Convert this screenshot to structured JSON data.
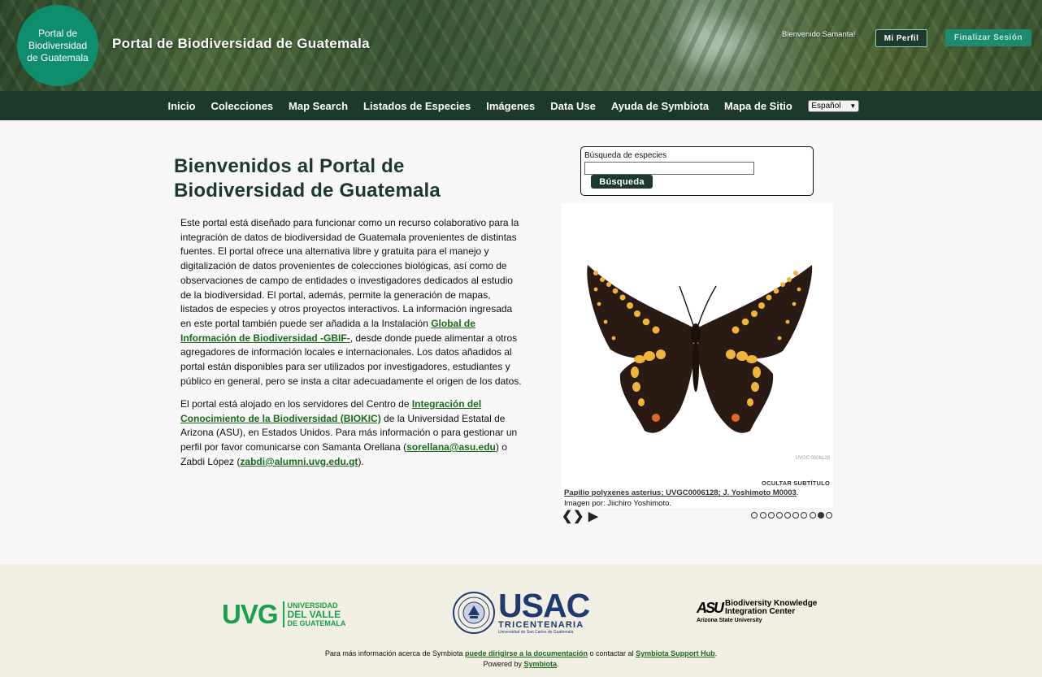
{
  "header": {
    "logo_text": "Portal de Biodiversidad de Guatemala",
    "site_title": "Portal de Biodiversidad de Guatemala",
    "welcome": "Bienvenido Samanta!",
    "profile_button": "Mi Perfil",
    "logout_button": "Finalizar Sesión"
  },
  "nav": {
    "items": [
      {
        "label": "Inicio"
      },
      {
        "label": "Colecciones"
      },
      {
        "label": "Map Search"
      },
      {
        "label": "Listados de Especies"
      },
      {
        "label": "Imágenes"
      },
      {
        "label": "Data Use"
      },
      {
        "label": "Ayuda de Symbiota"
      },
      {
        "label": "Mapa de Sitio"
      }
    ],
    "language": "Español"
  },
  "main": {
    "title": "Bienvenidos al Portal de Biodiversidad de Guatemala",
    "p1_a": "Este portal está diseñado para funcionar como un recurso colaborativo para la integración de datos de biodiversidad de Guatemala provenientes de distintas fuentes. El portal ofrece una alternativa libre y gratuita para el manejo y digitalización de datos provenientes de colecciones biológicas, así como de observaciones de campo de entidades o investigadores dedicados al estudio de la biodiversidad. El portal, además, permite la generación de mapas, listados de especies y otros proyectos interactivos. La información ingresada en este portal también puede ser añadida a la Instalación ",
    "p1_link": "Global de Información de Biodiversidad -GBIF-",
    "p1_b": ", desde donde puede alimentar a otros agregadores de información locales e internacionales. Los datos añadidos al portal están disponibles para ser utilizados por investigadores, estudiantes y público en general, pero se insta a citar adecuadamente el origen de los datos.",
    "p2_a": "El portal está alojado en los servidores del Centro de ",
    "p2_link1": "Integración del Conocimiento de la Biodiversidad (BIOKIC)",
    "p2_b": " de la Universidad Estatal de Arizona (ASU), en Estados Unidos. Para más información o para gestionar un perfil por favor comunicarse con Samanta Orellana (",
    "p2_link2": "sorellana@asu.edu",
    "p2_c": ") o Zabdi López (",
    "p2_link3": "zabdi@alumni.uvg.edu.gt",
    "p2_d": ")."
  },
  "search": {
    "label": "Búsqueda de especies",
    "value": "",
    "button": "Búsqueda"
  },
  "slideshow": {
    "catalog_number": "UVGC 0006128",
    "hide_caption": "OCULTAR SUBTÍTULO",
    "caption_link": "Papilio polyxenes asterius; UVGC0006128; J. Yoshimoto M0003",
    "caption_end": ".",
    "credit": "Imagen por: Jiichiro Yoshimoto.",
    "dots_total": 10,
    "active_dot": 9
  },
  "footer": {
    "uvg_big": "UVG",
    "uvg_line1": "UNIVERSIDAD",
    "uvg_line2": "DEL VALLE",
    "uvg_line3": "DE GUATEMALA",
    "usac_big": "USAC",
    "usac_tri": "TRICENTENARIA",
    "usac_sub": "Universidad de San Carlos de Guatemala",
    "asu_mark": "ASU",
    "asu_line1": "Biodiversity Knowledge",
    "asu_line2": "Integration Center",
    "asu_univ": "Arizona State University",
    "line1_a": "Para más información acerca de Symbiota ",
    "line1_link1": "puede dirigirse a la documentación",
    "line1_b": " o contactar al ",
    "line1_link2": "Symbiota Support Hub",
    "line1_c": ".",
    "line2_a": "Powered by ",
    "line2_link": "Symbiota",
    "line2_b": "."
  },
  "colors": {
    "nav_bg": "#1c3a2c",
    "logo_circle": "#0f8e6e",
    "link": "#1b6b1b",
    "uvg_green": "#19a04b",
    "usac_blue": "#1e3a6e"
  }
}
